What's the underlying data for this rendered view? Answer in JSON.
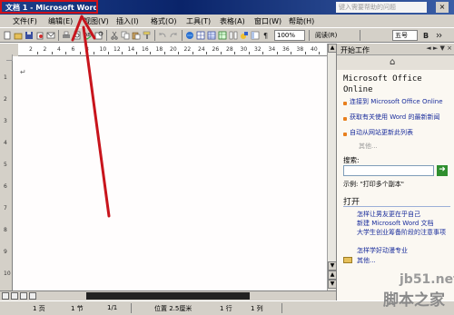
{
  "window": {
    "title": "文档 1 - Microsoft Word",
    "help_placeholder": "键入需要帮助的问题",
    "close_glyph": "×"
  },
  "menu": {
    "items": [
      "文件(F)",
      "编辑(E)",
      "视图(V)",
      "插入(I)",
      "格式(O)",
      "工具(T)",
      "表格(A)",
      "窗口(W)",
      "帮助(H)"
    ]
  },
  "toolbar": {
    "zoom": "100%",
    "read_label": "阅读(R)",
    "font_size": "五号",
    "icons": [
      "new-icon",
      "open-icon",
      "save-icon",
      "permission-icon",
      "email-icon",
      "print-icon",
      "print-preview-icon",
      "spelling-icon",
      "research-icon",
      "cut-icon",
      "copy-icon",
      "paste-icon",
      "format-painter-icon",
      "undo-icon",
      "redo-icon",
      "hyperlink-icon",
      "tables-icon",
      "insert-table-icon",
      "excel-icon",
      "columns-icon",
      "drawing-icon",
      "document-map-icon",
      "show-hide-icon"
    ]
  },
  "ruler": {
    "numbers": [
      "2",
      "2",
      "4",
      "6",
      "8",
      "10",
      "12",
      "14",
      "16",
      "18",
      "20",
      "22",
      "24",
      "26",
      "28",
      "30",
      "32",
      "34",
      "36",
      "38",
      "40"
    ],
    "vertical_numbers": [
      "1",
      "2",
      "3",
      "4",
      "5",
      "6",
      "7",
      "8",
      "9",
      "10"
    ]
  },
  "document": {
    "paragraph_mark": "↵"
  },
  "status": {
    "page": "1 页",
    "section": "1 节",
    "page_of": "1/1",
    "position": "位置 2.5厘米",
    "line": "1 行",
    "column": "1 列"
  },
  "taskpane": {
    "title": "开始工作",
    "brand": "Microsoft Office Online",
    "links": [
      "连接到 Microsoft Office Online",
      "获取有关使用 Word 的最新新闻",
      "自动从网站更新此列表"
    ],
    "more": "其他...",
    "search_label": "搜索:",
    "example": "示例:  \"打印多个副本\"",
    "open_section": "打开",
    "files": [
      "怎样让男友更在乎自己",
      "新建 Microsoft Word 文档",
      "大学生创业筹备阶段的注意事项",
      "怎样学好动漫专业"
    ],
    "other_files": "其他..."
  },
  "watermark": {
    "site": "jb51.net",
    "name": "脚本之家"
  },
  "colors": {
    "annotation": "#c8141c",
    "chrome": "#d4d0c8",
    "titlebar": "#0a246a",
    "link": "#1a2d9c"
  }
}
